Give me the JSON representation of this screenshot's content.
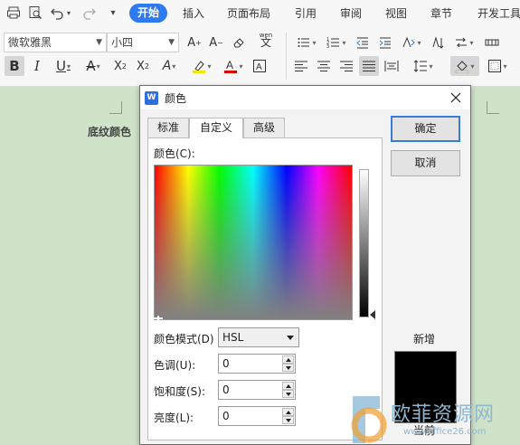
{
  "menubar": {
    "items": [
      "开始",
      "插入",
      "页面布局",
      "引用",
      "审阅",
      "视图",
      "章节",
      "开发工具"
    ]
  },
  "toolbar": {
    "font_name": "微软雅黑",
    "font_size": "小四",
    "pinyin_label": "wen"
  },
  "document": {
    "label": "底纹颜色"
  },
  "dialog": {
    "title": "颜色",
    "tabs": [
      "标准",
      "自定义",
      "高级"
    ],
    "active_tab": "自定义",
    "color_label": "颜色(C):",
    "mode_label": "颜色模式(D)",
    "mode_value": "HSL",
    "fields": [
      {
        "label": "色调(U):",
        "value": "0"
      },
      {
        "label": "饱和度(S):",
        "value": "0"
      },
      {
        "label": "亮度(L):",
        "value": "0"
      }
    ],
    "ok_label": "确定",
    "cancel_label": "取消",
    "new_label": "新增",
    "current_label": "当前",
    "new_color": "#000000"
  },
  "watermark": {
    "cn": "欧菲资源网",
    "en": "www.office26.com"
  },
  "colors": {
    "accent": "#2e7bf0",
    "page_bg": "#cfe3c8",
    "dialog_bg": "#f3f3f3"
  }
}
